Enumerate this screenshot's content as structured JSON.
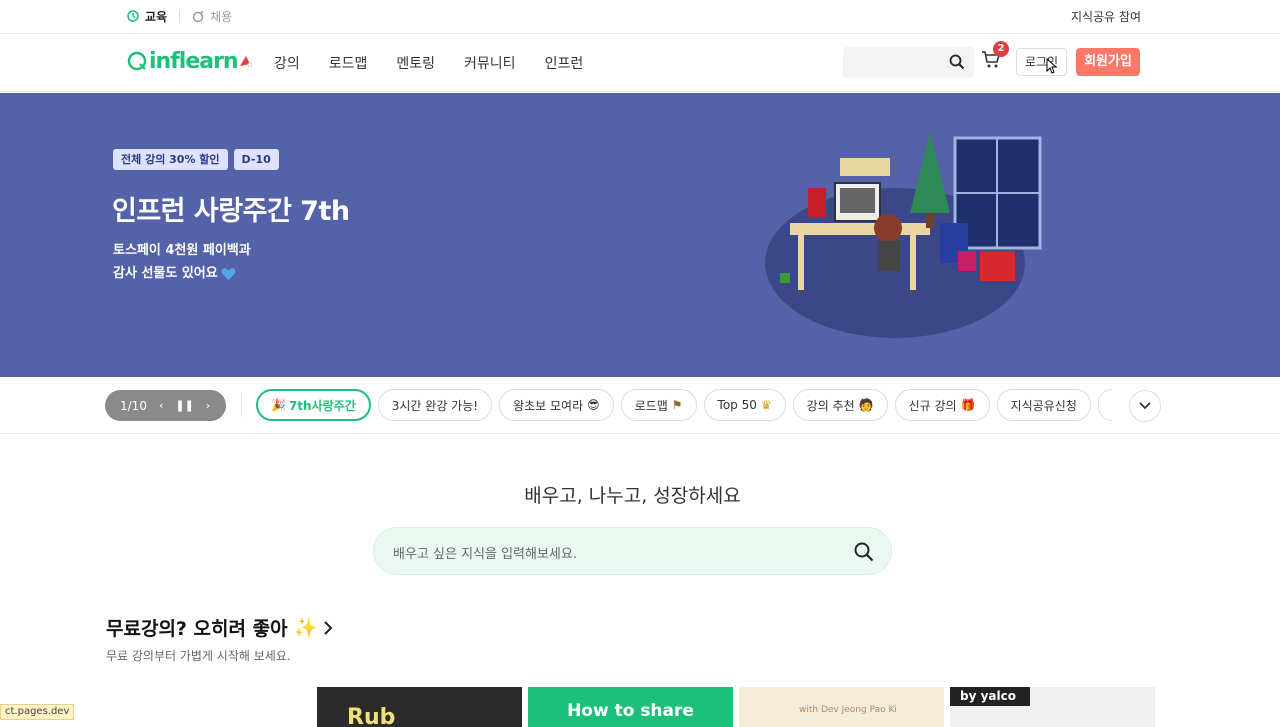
{
  "topbar": {
    "tabs": [
      {
        "label": "교육",
        "active": true
      },
      {
        "label": "채용",
        "active": false
      }
    ],
    "right_link": "지식공유 참여"
  },
  "header": {
    "logo_text": "inflearn",
    "nav": [
      "강의",
      "로드맵",
      "멘토링",
      "커뮤니티",
      "인프런"
    ],
    "search_placeholder": "",
    "cart_count": "2",
    "login_label": "로그인",
    "signup_label": "회원가입"
  },
  "hero": {
    "badges": [
      "전체 강의 30% 할인",
      "D-10"
    ],
    "title": "인프런 사랑주간 7th",
    "subtitle_line1": "토스페이 4천원 페이백과",
    "subtitle_line2": "감사 선물도 있어요",
    "background_color": "#5462a8"
  },
  "strip": {
    "pager": {
      "label": "1/10"
    },
    "chips": [
      {
        "label": "7th사랑주간",
        "active": true
      },
      {
        "label": "3시간 완강 가능!",
        "active": false
      },
      {
        "label": "왕초보 모여라",
        "active": false
      },
      {
        "label": "로드맵",
        "active": false
      },
      {
        "label": "Top 50",
        "active": false
      },
      {
        "label": "강의 추천",
        "active": false
      },
      {
        "label": "신규 강의",
        "active": false
      },
      {
        "label": "지식공유신청",
        "active": false
      }
    ]
  },
  "main": {
    "tagline": "배우고, 나누고, 성장하세요",
    "search_placeholder": "배우고 싶은 지식을 입력해보세요."
  },
  "section": {
    "title": "무료강의? 오히려 좋아",
    "subtitle": "무료 강의부터 가볍게 시작해 보세요."
  },
  "thumbnails": [
    {
      "label": "Rub"
    },
    {
      "label": "How to share"
    },
    {
      "label": "with Dev Jeong Pao Ki"
    },
    {
      "label": "by yalco"
    }
  ],
  "statusbar": {
    "text": "ct.pages.dev"
  },
  "colors": {
    "brand": "#1dc078",
    "signup": "#ff7867",
    "badge_red": "#e53e3e"
  }
}
